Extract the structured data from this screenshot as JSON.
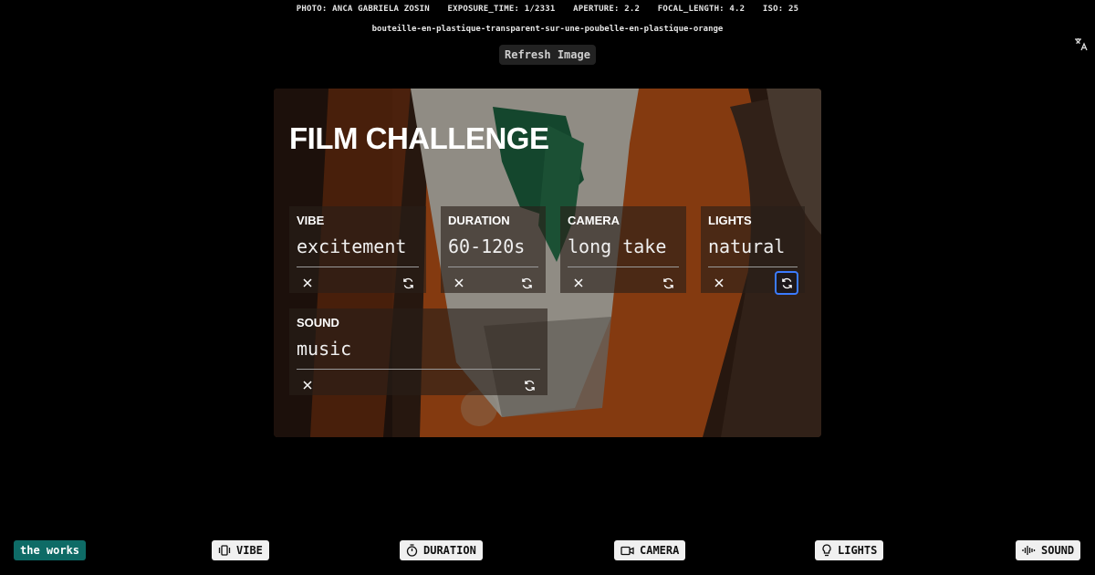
{
  "meta": {
    "photo": "PHOTO: ANCA GABRIELA ZOSIN",
    "exposure": "EXPOSURE_TIME: 1/2331",
    "aperture": "APERTURE: 2.2",
    "focal": "FOCAL_LENGTH: 4.2",
    "iso": "ISO: 25"
  },
  "slug": "bouteille-en-plastique-transparent-sur-une-poubelle-en-plastique-orange",
  "refresh_label": "Refresh Image",
  "card": {
    "title": "FILM CHALLENGE",
    "panels": [
      {
        "label": "VIBE",
        "value": "excitement"
      },
      {
        "label": "DURATION",
        "value": "60-120s"
      },
      {
        "label": "CAMERA",
        "value": "long take"
      },
      {
        "label": "LIGHTS",
        "value": "natural"
      },
      {
        "label": "SOUND",
        "value": "music"
      }
    ]
  },
  "bottom": {
    "works": "the works",
    "vibe": "VIBE",
    "duration": "DURATION",
    "camera": "CAMERA",
    "lights": "LIGHTS",
    "sound": "SOUND"
  },
  "colors": {
    "accent": "#0e6b66",
    "focus": "#3b7bff"
  }
}
